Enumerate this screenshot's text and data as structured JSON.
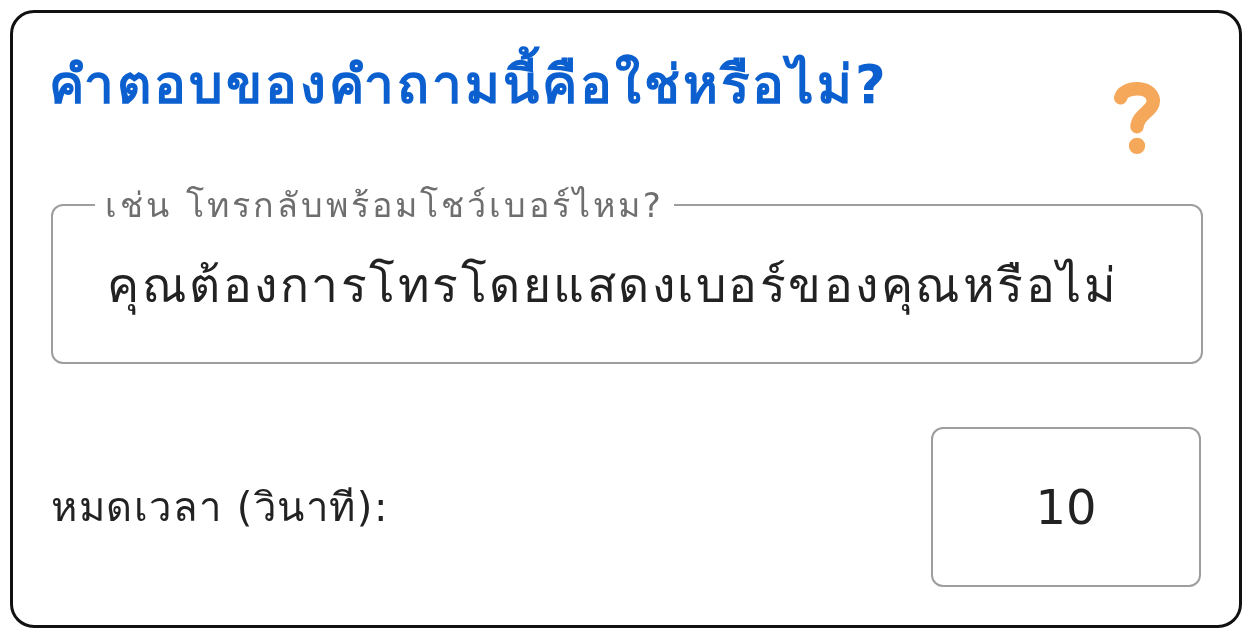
{
  "title": "คำตอบของคำถามนี้คือใช่หรือไม่?",
  "question_field": {
    "label": "เช่น โทรกลับพร้อมโชว์เบอร์ไหม?",
    "value": "คุณต้องการโทรโดยแสดงเบอร์ของคุณหรือไม่"
  },
  "timeout": {
    "label": "หมดเวลา (วินาที):",
    "value": "10"
  }
}
